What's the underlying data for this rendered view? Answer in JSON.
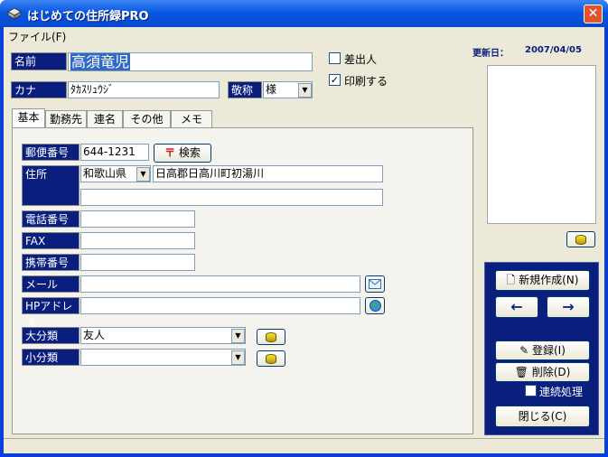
{
  "window": {
    "title": "はじめての住所録PRO"
  },
  "menu": {
    "file": "ファイル(F)"
  },
  "header": {
    "name_label": "名前",
    "name_value": "高須竜児",
    "kana_label": "カナ",
    "kana_value": "ﾀｶｽﾘｭｳｼﾞ",
    "honorific_label": "敬称",
    "honorific_value": "様",
    "sender_label": "差出人",
    "sender_checked": false,
    "print_label": "印刷する",
    "print_checked": true,
    "updated_label": "更新日：",
    "updated_value": "2007/04/05"
  },
  "tabs": [
    "基本",
    "勤務先",
    "連名",
    "その他",
    "メモ"
  ],
  "basic": {
    "zip_label": "郵便番号",
    "zip_value": "644-1231",
    "search_button": "検索",
    "address_label": "住所",
    "prefecture": "和歌山県",
    "address1": "日高郡日高川町初湯川",
    "address2": "",
    "phone_label": "電話番号",
    "phone_value": "",
    "fax_label": "FAX",
    "fax_value": "",
    "mobile_label": "携帯番号",
    "mobile_value": "",
    "mail_label": "メール",
    "mail_value": "",
    "hp_label": "HPアドレス",
    "hp_value": "",
    "major_label": "大分類",
    "major_value": "友人",
    "minor_label": "小分類",
    "minor_value": ""
  },
  "nav": {
    "new_button": "新規作成(N)",
    "prev_arrow": "←",
    "next_arrow": "→",
    "register_button": "登録(I)",
    "delete_button": "削除(D)",
    "continuous_label": "連続処理",
    "continuous_checked": false,
    "close_button": "閉じる(C)"
  }
}
